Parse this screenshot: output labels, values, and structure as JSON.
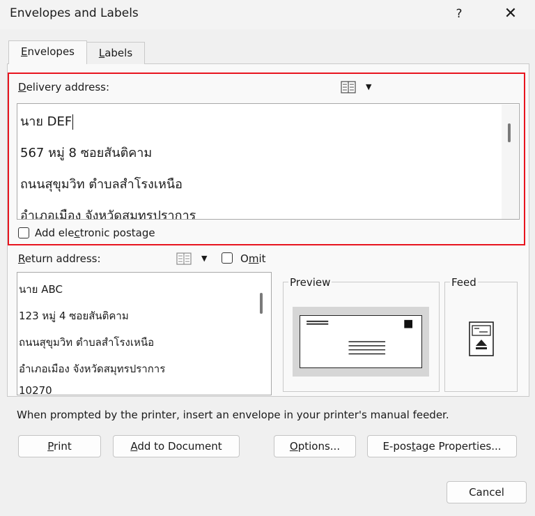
{
  "window": {
    "title": "Envelopes and Labels",
    "help_glyph": "?",
    "close_glyph": "✕"
  },
  "tabs": [
    {
      "label_pre": "",
      "label_key": "E",
      "label_post": "nvelopes",
      "selected": true
    },
    {
      "label_pre": "",
      "label_key": "L",
      "label_post": "abels",
      "selected": false
    }
  ],
  "delivery": {
    "label_pre": "",
    "label_key": "D",
    "label_post": "elivery address:",
    "address_book_icon": "address-book-icon",
    "lines": [
      "นาย DEF",
      "567 หมู่ 8 ซอยสันติคาม",
      "ถนนสุขุมวิท ตำบลสำโรงเหนือ",
      "อำเภอเมือง จังหวัดสมุทรปราการ"
    ],
    "postage_label_pre": "Add ele",
    "postage_label_key": "c",
    "postage_label_post": "tronic postage",
    "postage_checked": false
  },
  "return_address": {
    "label_pre": "",
    "label_key": "R",
    "label_post": "eturn address:",
    "omit_pre": "O",
    "omit_key": "m",
    "omit_post": "it",
    "omit_checked": false,
    "lines": [
      "นาย ABC",
      "123 หมู่ 4 ซอยสันติคาม",
      "ถนนสุขุมวิท ตำบลสำโรงเหนือ",
      "อำเภอเมือง จังหวัดสมุทรปราการ",
      "10270"
    ]
  },
  "preview": {
    "label": "Preview"
  },
  "feed": {
    "label": "Feed"
  },
  "instruction": "When prompted by the printer, insert an envelope in your printer's manual feeder.",
  "buttons": {
    "print_key": "P",
    "print_post": "rint",
    "add_doc_pre": "",
    "add_doc_key": "A",
    "add_doc_post": "dd to Document",
    "options_key": "O",
    "options_post": "ptions...",
    "epostage_pre": "E-pos",
    "epostage_key": "t",
    "epostage_post": "age Properties...",
    "cancel": "Cancel"
  },
  "colors": {
    "highlight_border": "#e8141e"
  }
}
